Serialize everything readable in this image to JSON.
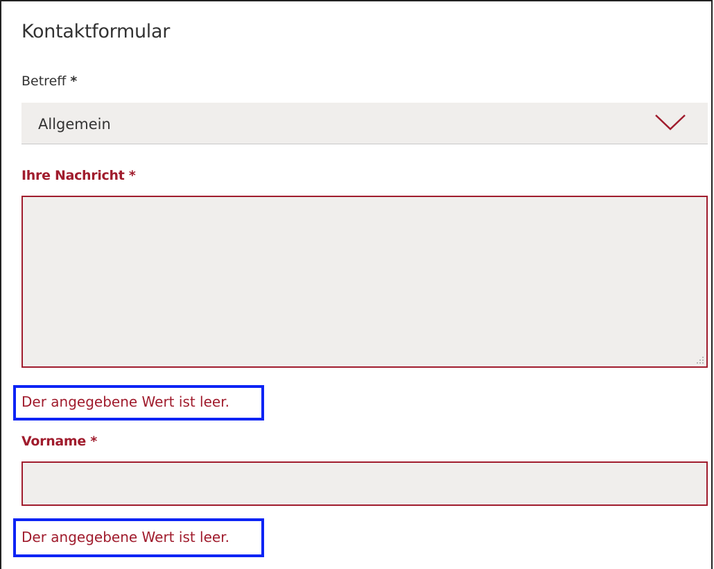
{
  "form": {
    "title": "Kontaktformular",
    "subject": {
      "label": "Betreff",
      "required_mark": "*",
      "selected_value": "Allgemein"
    },
    "message": {
      "label": "Ihre Nachricht",
      "required_mark": "*",
      "value": "",
      "error": "Der angegebene Wert ist leer."
    },
    "first_name": {
      "label": "Vorname",
      "required_mark": "*",
      "value": "",
      "error": "Der angegebene Wert ist leer."
    }
  },
  "colors": {
    "error": "#a01c2d",
    "field_background": "#f0eeec",
    "highlight": "#0b24f5",
    "text": "#333333"
  },
  "icons": {
    "select_indicator": "chevron-down-icon",
    "textarea_resize": "resize-grip-icon"
  }
}
